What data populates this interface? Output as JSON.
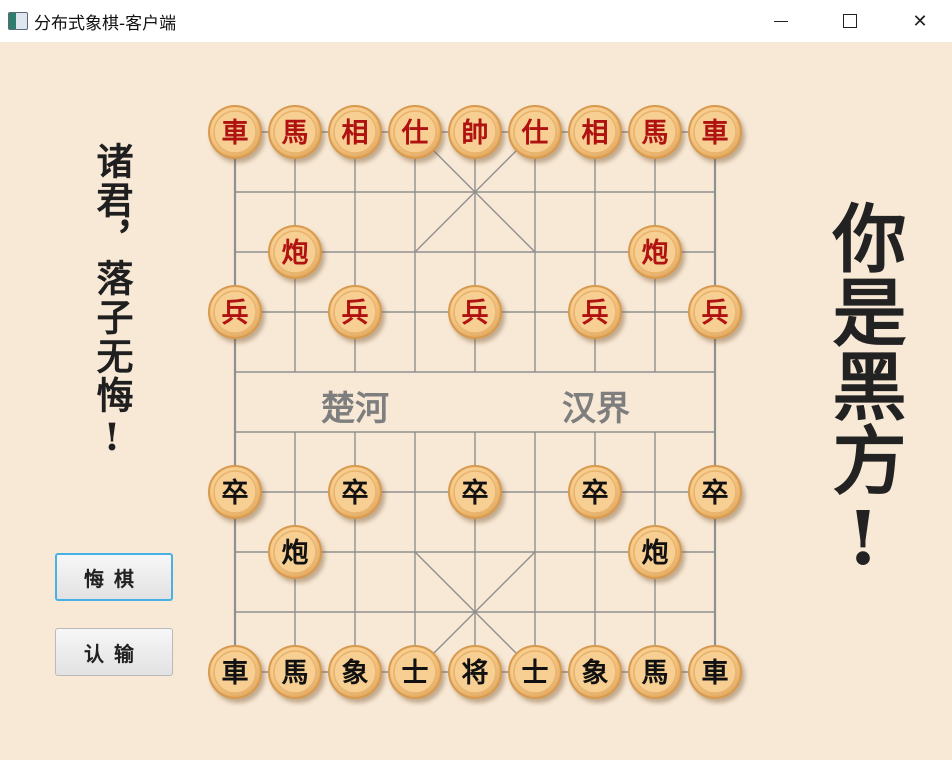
{
  "window": {
    "title": "分布式象棋-客户端",
    "minimize_icon": "minimize-icon",
    "maximize_icon": "maximize-icon",
    "close_icon": "close-icon"
  },
  "left_motto": "诸君，落子无悔!",
  "right_motto": "你是黑方!",
  "buttons": {
    "undo": "悔棋",
    "resign": "认输"
  },
  "river": {
    "left": "楚河",
    "right": "汉界"
  },
  "colors": {
    "background": "#f8e9d7",
    "red_text": "#b01212",
    "black_text": "#111111",
    "piece_fill": "#f7cf93",
    "board_line": "#8f8f8f",
    "focus_border": "#47b1e6"
  },
  "pieces": [
    {
      "label": "車",
      "side": "red",
      "col": 0,
      "row": 0
    },
    {
      "label": "馬",
      "side": "red",
      "col": 1,
      "row": 0
    },
    {
      "label": "相",
      "side": "red",
      "col": 2,
      "row": 0
    },
    {
      "label": "仕",
      "side": "red",
      "col": 3,
      "row": 0
    },
    {
      "label": "帥",
      "side": "red",
      "col": 4,
      "row": 0
    },
    {
      "label": "仕",
      "side": "red",
      "col": 5,
      "row": 0
    },
    {
      "label": "相",
      "side": "red",
      "col": 6,
      "row": 0
    },
    {
      "label": "馬",
      "side": "red",
      "col": 7,
      "row": 0
    },
    {
      "label": "車",
      "side": "red",
      "col": 8,
      "row": 0
    },
    {
      "label": "炮",
      "side": "red",
      "col": 1,
      "row": 2
    },
    {
      "label": "炮",
      "side": "red",
      "col": 7,
      "row": 2
    },
    {
      "label": "兵",
      "side": "red",
      "col": 0,
      "row": 3
    },
    {
      "label": "兵",
      "side": "red",
      "col": 2,
      "row": 3
    },
    {
      "label": "兵",
      "side": "red",
      "col": 4,
      "row": 3
    },
    {
      "label": "兵",
      "side": "red",
      "col": 6,
      "row": 3
    },
    {
      "label": "兵",
      "side": "red",
      "col": 8,
      "row": 3
    },
    {
      "label": "卒",
      "side": "black",
      "col": 0,
      "row": 6
    },
    {
      "label": "卒",
      "side": "black",
      "col": 2,
      "row": 6
    },
    {
      "label": "卒",
      "side": "black",
      "col": 4,
      "row": 6
    },
    {
      "label": "卒",
      "side": "black",
      "col": 6,
      "row": 6
    },
    {
      "label": "卒",
      "side": "black",
      "col": 8,
      "row": 6
    },
    {
      "label": "炮",
      "side": "black",
      "col": 1,
      "row": 7
    },
    {
      "label": "炮",
      "side": "black",
      "col": 7,
      "row": 7
    },
    {
      "label": "車",
      "side": "black",
      "col": 0,
      "row": 9
    },
    {
      "label": "馬",
      "side": "black",
      "col": 1,
      "row": 9
    },
    {
      "label": "象",
      "side": "black",
      "col": 2,
      "row": 9
    },
    {
      "label": "士",
      "side": "black",
      "col": 3,
      "row": 9
    },
    {
      "label": "将",
      "side": "black",
      "col": 4,
      "row": 9
    },
    {
      "label": "士",
      "side": "black",
      "col": 5,
      "row": 9
    },
    {
      "label": "象",
      "side": "black",
      "col": 6,
      "row": 9
    },
    {
      "label": "馬",
      "side": "black",
      "col": 7,
      "row": 9
    },
    {
      "label": "車",
      "side": "black",
      "col": 8,
      "row": 9
    }
  ]
}
